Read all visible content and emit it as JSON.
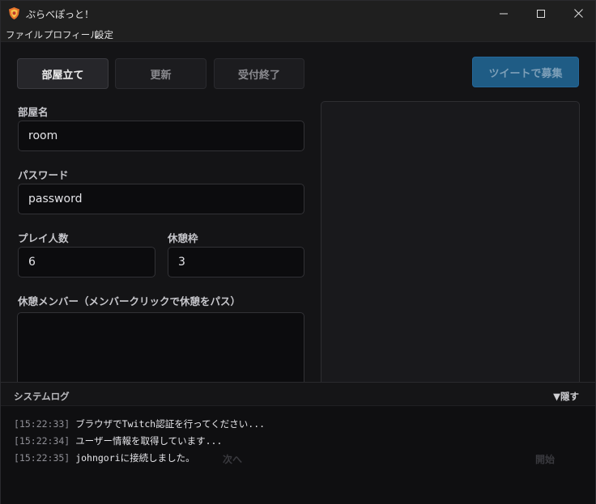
{
  "window": {
    "title": "ぷらべぽっと！"
  },
  "menu": [
    "ファイル",
    "プロフィール",
    "設定"
  ],
  "toolbar": {
    "create_label": "部屋立て",
    "update_label": "更新",
    "close_label": "受付終了",
    "tweet_label": "ツイートで募集"
  },
  "form": {
    "room_name_label": "部屋名",
    "room_name_value": "room",
    "password_label": "パスワード",
    "password_value": "password",
    "players_label": "プレイ人数",
    "players_value": "6",
    "rest_slots_label": "休憩枠",
    "rest_slots_value": "3",
    "rest_members_label": "休憩メンバー（メンバークリックで休憩をパス）"
  },
  "hidden_buttons": {
    "left_label": "次へ",
    "right_label": "開始"
  },
  "log": {
    "title": "システムログ",
    "toggle_label": "▼隠す",
    "entries": [
      {
        "time": "[15:22:33]",
        "message": "ブラウザでTwitch認証を行ってください..."
      },
      {
        "time": "[15:22:34]",
        "message": "ユーザー情報を取得しています..."
      },
      {
        "time": "[15:22:35]",
        "message": "johngoriに接続しました。"
      }
    ]
  },
  "colors": {
    "accent": "#1f5c85",
    "background": "#141416",
    "input_bg": "#0c0c0e"
  }
}
